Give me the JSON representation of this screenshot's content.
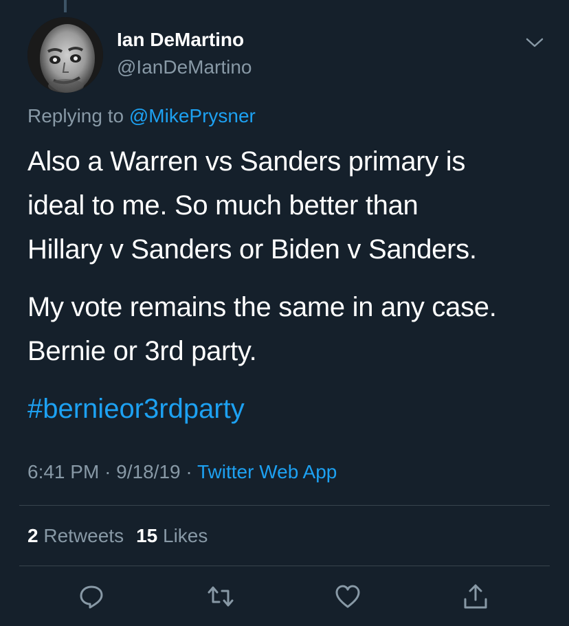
{
  "tweet": {
    "display_name": "Ian DeMartino",
    "handle": "@IanDeMartino",
    "replying_prefix": "Replying to",
    "replying_to": "@MikePrysner",
    "text_lines_1": [
      "Also a Warren vs Sanders primary is",
      "ideal to me. So much better than",
      "Hillary v Sanders or Biden v Sanders."
    ],
    "text_lines_2": [
      "My vote remains the same in any case.",
      "Bernie or 3rd party."
    ],
    "hashtag": "#bernieor3rdparty",
    "time": "6:41 PM",
    "date": "9/18/19",
    "separator": "·",
    "source": "Twitter Web App"
  },
  "stats": {
    "retweets_count": "2",
    "retweets_label": "Retweets",
    "likes_count": "15",
    "likes_label": "Likes"
  },
  "icons": {
    "menu": "chevron-down-icon",
    "reply": "reply-icon",
    "retweet": "retweet-icon",
    "like": "heart-icon",
    "share": "share-icon"
  },
  "colors": {
    "background": "#15202b",
    "link": "#1da1f2",
    "secondary_text": "#8899a6",
    "divider": "#38444d"
  }
}
